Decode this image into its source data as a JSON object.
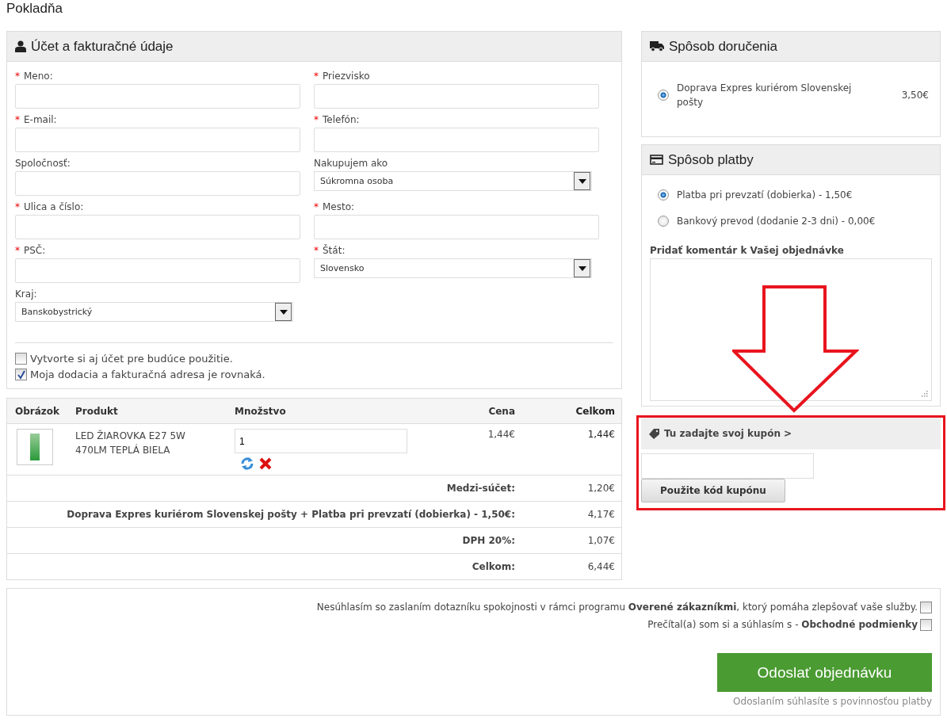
{
  "page_title": "Pokladňa",
  "billing": {
    "title": "Účet a fakturačné údaje",
    "required_mark": "*",
    "fields": [
      {
        "kind": "text",
        "label": "Meno:",
        "required": true
      },
      {
        "kind": "text",
        "label": "Priezvisko",
        "required": true
      },
      {
        "kind": "text",
        "label": "E-mail:",
        "required": true
      },
      {
        "kind": "text",
        "label": "Telefón:",
        "required": true
      },
      {
        "kind": "text",
        "label": "Spoločnosť:",
        "required": false
      },
      {
        "kind": "select",
        "label": "Nakupujem ako",
        "required": false,
        "value": "Súkromna osoba"
      },
      {
        "kind": "text",
        "label": "Ulica a číslo:",
        "required": true
      },
      {
        "kind": "text",
        "label": "Mesto:",
        "required": true
      },
      {
        "kind": "text",
        "label": "PSČ:",
        "required": true
      },
      {
        "kind": "select",
        "label": "Štát:",
        "required": true,
        "value": "Slovensko"
      },
      {
        "kind": "select",
        "label": "Kraj:",
        "required": false,
        "value": "Banskobystrický"
      }
    ],
    "checkboxes": [
      {
        "label": "Vytvorte si aj účet pre budúce použitie.",
        "checked": false
      },
      {
        "label": "Moja dodacia a fakturačná adresa je rovnaká.",
        "checked": true
      }
    ]
  },
  "cart": {
    "columns": [
      "Obrázok",
      "Produkt",
      "Množstvo",
      "Cena",
      "Celkom"
    ],
    "items": [
      {
        "product": "LED ŽIAROVKA E27 5W 470LM TEPLÁ BIELA",
        "quantity": "1",
        "price": "1,44€",
        "total": "1,44€"
      }
    ],
    "totals": [
      {
        "label": "Medzi-súčet:",
        "value": "1,20€"
      },
      {
        "label": "Doprava Expres kuriérom Slovenskej pošty + Platba pri prevzatí (dobierka) - 1,50€:",
        "value": "4,17€"
      },
      {
        "label": "DPH 20%:",
        "value": "1,07€"
      },
      {
        "label": "Celkom:",
        "value": "6,44€"
      }
    ]
  },
  "delivery": {
    "title": "Spôsob doručenia",
    "options": [
      {
        "label": "Doprava Expres kuriérom Slovenskej pošty",
        "price": "3,50€",
        "selected": true
      }
    ]
  },
  "payment": {
    "title": "Spôsob platby",
    "options": [
      {
        "label": "Platba pri prevzatí (dobierka) - 1,50€",
        "selected": true
      },
      {
        "label": "Bankový prevod (dodanie 2-3 dni) - 0,00€",
        "selected": false
      }
    ],
    "comment_label": "Pridať komentár k Vašej objednávke"
  },
  "coupon": {
    "title": "Tu zadajte svoj kupón >",
    "button": "Použite kód kupónu"
  },
  "agreements": [
    {
      "text": "Nesúhlasím so zaslaním dotazníku spokojnosti v rámci programu **Overené zákazníkmi**, ktorý pomáha zlepšovať vaše služby.",
      "checked": false
    },
    {
      "text": "Prečítal(a) som si a súhlasím s - **Obchodné podmienky**",
      "checked": false
    }
  ],
  "submit": {
    "button": "Odoslať objednávku",
    "note": "Odoslaním súhlasíte s povinnosťou platby"
  }
}
